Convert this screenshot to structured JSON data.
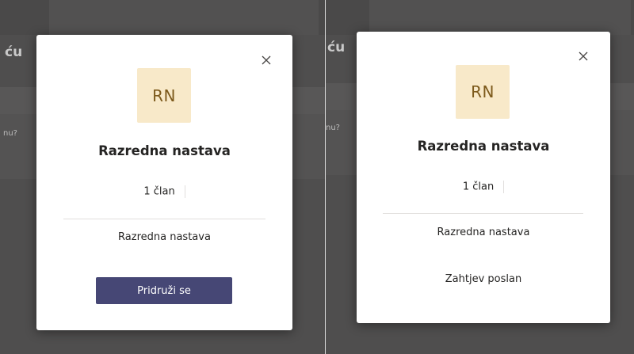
{
  "background": {
    "left_title_fragment": "ću",
    "left_question_fragment": "nu?",
    "right_title_fragment": "ću",
    "right_question_fragment": "nu?"
  },
  "join_dialog": {
    "avatar_initials": "RN",
    "team_name": "Razredna nastava",
    "member_count": "1 član",
    "description": "Razredna nastava",
    "join_label": "Pridruži se"
  },
  "request_dialog": {
    "avatar_initials": "RN",
    "team_name": "Razredna nastava",
    "member_count": "1 član",
    "description": "Razredna nastava",
    "status_text": "Zahtjev poslan"
  },
  "colors": {
    "overlay": "#4f4e4e",
    "avatar_bg": "#f8e9c9",
    "avatar_text": "#7d5a1c",
    "primary_button": "#464775"
  }
}
